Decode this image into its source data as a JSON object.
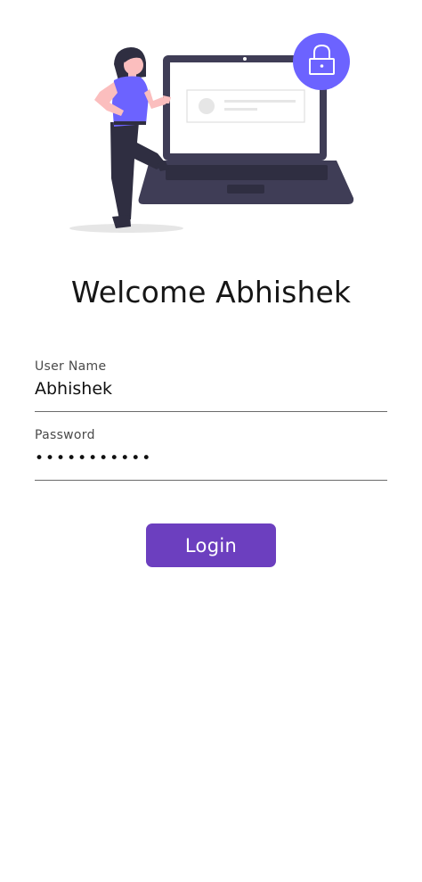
{
  "login": {
    "title": "Welcome Abhishek",
    "username_label": "User Name",
    "username_value": "Abhishek",
    "password_label": "Password",
    "password_value": "•••••••••••",
    "login_button": "Login"
  },
  "colors": {
    "accent": "#6c3fbf",
    "illustration_purple": "#6c63ff",
    "laptop_dark": "#3f3d56"
  },
  "icons": {
    "hero": "woman-with-laptop-illustration",
    "lock": "lock-icon"
  }
}
